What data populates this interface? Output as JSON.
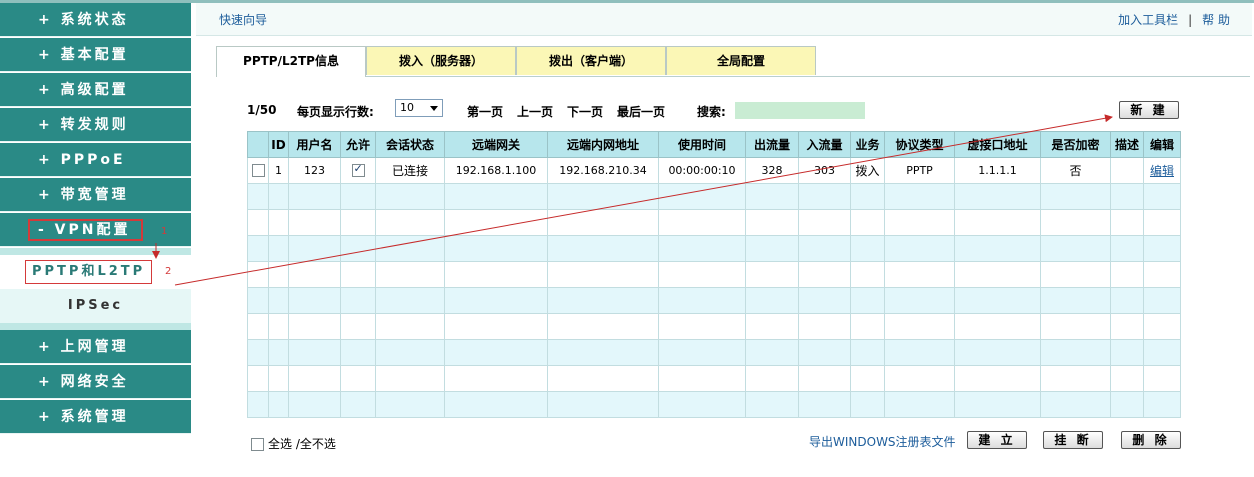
{
  "sidebar": {
    "items_top": [
      {
        "label": "+ 系统状态"
      },
      {
        "label": "+ 基本配置"
      },
      {
        "label": "+ 高级配置"
      },
      {
        "label": "+ 转发规则"
      },
      {
        "label": "+ PPPoE"
      },
      {
        "label": "+ 带宽管理"
      }
    ],
    "vpn_label": "- VPN配置",
    "sub_items": [
      {
        "label": "PPTP和L2TP"
      },
      {
        "label": "IPSec"
      }
    ],
    "items_bottom": [
      {
        "label": "+ 上网管理"
      },
      {
        "label": "+ 网络安全"
      },
      {
        "label": "+ 系统管理"
      }
    ],
    "annotation_1": "1",
    "annotation_2": "2"
  },
  "header": {
    "quick_guide": "快速向导",
    "add_toolbar": "加入工具栏",
    "separator": "|",
    "help": "帮 助"
  },
  "tabs": [
    {
      "label": "PPTP/L2TP信息",
      "active": true
    },
    {
      "label": "拨入（服务器）",
      "active": false
    },
    {
      "label": "拨出（客户端）",
      "active": false
    },
    {
      "label": "全局配置",
      "active": false
    }
  ],
  "pager": {
    "page": "1/50",
    "rows_label": "每页显示行数:",
    "rows_value": "10",
    "first": "第一页",
    "prev": "上一页",
    "next": "下一页",
    "last": "最后一页",
    "search_label": "搜索:",
    "search_value": ""
  },
  "buttons": {
    "new": "新 建",
    "create": "建 立",
    "hangup": "挂 断",
    "delete": "删 除"
  },
  "table": {
    "columns": [
      "",
      "ID",
      "用户名",
      "允许",
      "会话状态",
      "远端网关",
      "远端内网地址",
      "使用时间",
      "出流量",
      "入流量",
      "业务",
      "协议类型",
      "虚接口地址",
      "是否加密",
      "描述",
      "编辑"
    ],
    "rows": [
      {
        "id": "1",
        "user": "123",
        "allow": true,
        "status": "已连接",
        "gateway": "192.168.1.100",
        "lan": "192.168.210.34",
        "time": "00:00:00:10",
        "out": "328",
        "in": "303",
        "service": "拨入",
        "protocol": "PPTP",
        "vif": "1.1.1.1",
        "encrypt": "否",
        "desc": "",
        "edit": "编辑"
      }
    ],
    "empty_rows": 9
  },
  "footer": {
    "select_all": "全选",
    "select_none": "/全不选",
    "export": "导出WINDOWS注册表文件"
  },
  "colors": {
    "sidebar": "#2a8a86",
    "header_row": "#b7e6ec",
    "even_row": "#e3f7fb",
    "tab_bg": "#fbf7b6",
    "annotation": "#d43a3a"
  }
}
